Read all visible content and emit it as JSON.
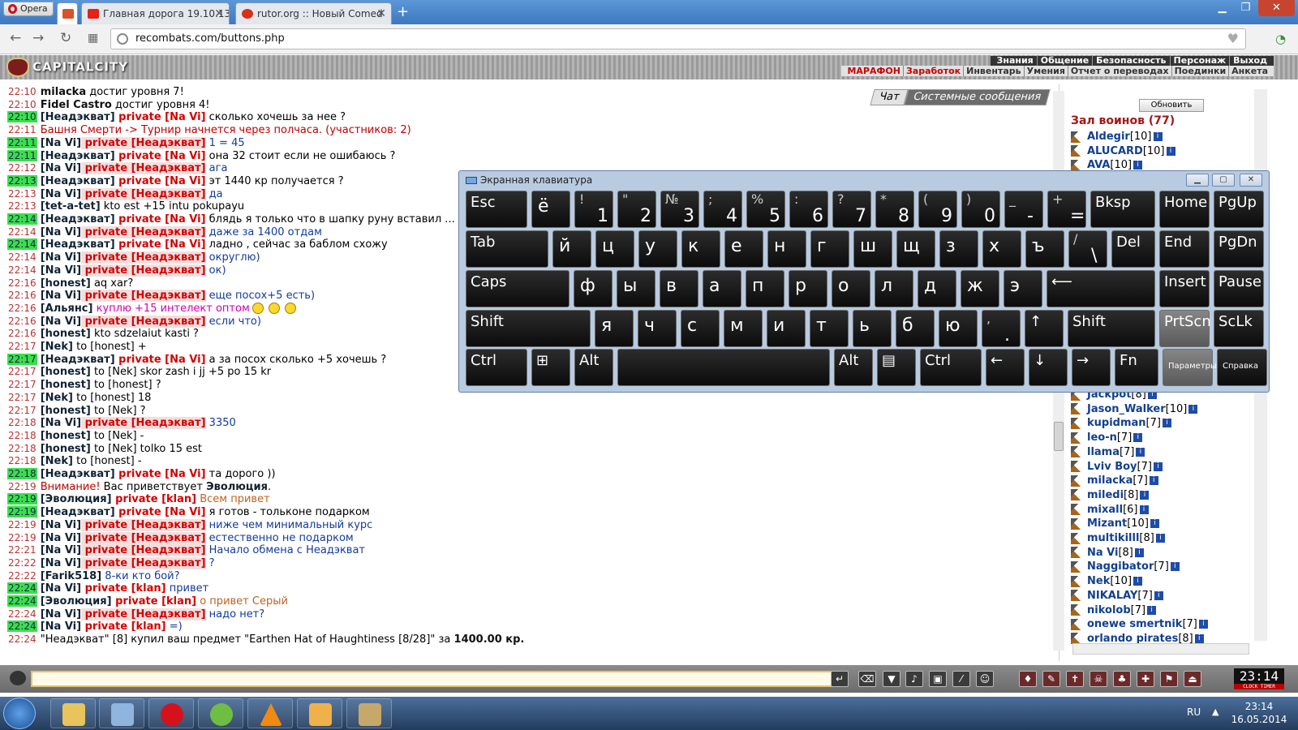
{
  "browser": {
    "menu_label": "Opera",
    "tabs": [
      {
        "label": ""
      },
      {
        "label": "Главная дорога 19.10.13 -"
      },
      {
        "label": "rutor.org :: Новый Comed"
      }
    ],
    "url": "recombats.com/buttons.php"
  },
  "game": {
    "logo": "CAPITALCITY",
    "top_menu": [
      "Знания",
      "Общение",
      "Безопасность",
      "Персонаж",
      "Выход"
    ],
    "sub_menu": [
      "МАРАФОН",
      "Заработок",
      "Инвентарь",
      "Умения",
      "Отчет о переводах",
      "Поединки",
      "Анкета"
    ],
    "chat_tabs": [
      "Чат",
      "Системные сообщения"
    ],
    "refresh_label": "Обновить",
    "hall_title": "Зал воинов (77)"
  },
  "chat": [
    {
      "ts": "22:10",
      "hl": false,
      "parts": [
        {
          "c": "nick",
          "t": "milacka"
        },
        {
          "c": "t",
          "t": " достиг уровня 7!"
        }
      ]
    },
    {
      "ts": "22:10",
      "hl": false,
      "parts": [
        {
          "c": "nick",
          "t": "Fidel Castro"
        },
        {
          "c": "t",
          "t": " достиг уровня 4!"
        }
      ]
    },
    {
      "ts": "22:10",
      "hl": true,
      "parts": [
        {
          "c": "br",
          "t": "[Неадэкват]"
        },
        {
          "c": "priv",
          "t": " private [Na Vi]"
        },
        {
          "c": "t",
          "t": " сколько хочешь за нее ?"
        }
      ]
    },
    {
      "ts": "22:11",
      "hl": false,
      "parts": [
        {
          "c": "tr",
          "t": "Башня Смерти -> "
        },
        {
          "c": "tr",
          "t": "Турнир начнется через полчаса. (участников: 2)"
        }
      ]
    },
    {
      "ts": "22:11",
      "hl": true,
      "parts": [
        {
          "c": "br",
          "t": "[Na Vi]"
        },
        {
          "c": "privb",
          "t": " private [Неадэкват]"
        },
        {
          "c": "tb",
          "t": " 1 = 45"
        }
      ]
    },
    {
      "ts": "22:11",
      "hl": true,
      "parts": [
        {
          "c": "br",
          "t": "[Неадэкват]"
        },
        {
          "c": "priv",
          "t": " private [Na Vi]"
        },
        {
          "c": "t",
          "t": " она 32 стоит если не ошибаюсь ?"
        }
      ]
    },
    {
      "ts": "22:12",
      "hl": false,
      "parts": [
        {
          "c": "br",
          "t": "[Na Vi]"
        },
        {
          "c": "privb",
          "t": " private [Неадэкват]"
        },
        {
          "c": "tb",
          "t": " ага"
        }
      ]
    },
    {
      "ts": "22:13",
      "hl": true,
      "parts": [
        {
          "c": "br",
          "t": "[Неадэкват]"
        },
        {
          "c": "priv",
          "t": " private [Na Vi]"
        },
        {
          "c": "t",
          "t": " эт 1440 кр получается ?"
        }
      ]
    },
    {
      "ts": "22:13",
      "hl": false,
      "parts": [
        {
          "c": "br",
          "t": "[Na Vi]"
        },
        {
          "c": "privb",
          "t": " private [Неадэкват]"
        },
        {
          "c": "tb",
          "t": " да"
        }
      ]
    },
    {
      "ts": "22:13",
      "hl": false,
      "parts": [
        {
          "c": "br",
          "t": "[tet-a-tet]"
        },
        {
          "c": "t",
          "t": " kto est +15 intu pokupayu"
        }
      ]
    },
    {
      "ts": "22:14",
      "hl": true,
      "parts": [
        {
          "c": "br",
          "t": "[Неадэкват]"
        },
        {
          "c": "priv",
          "t": " private [Na Vi]"
        },
        {
          "c": "t",
          "t": " блядь я только что в шапку руну вставил ..."
        }
      ]
    },
    {
      "ts": "22:14",
      "hl": false,
      "parts": [
        {
          "c": "br",
          "t": "[Na Vi]"
        },
        {
          "c": "privb",
          "t": " private [Неадэкват]"
        },
        {
          "c": "tb",
          "t": " даже за 1400 отдам"
        }
      ]
    },
    {
      "ts": "22:14",
      "hl": true,
      "parts": [
        {
          "c": "br",
          "t": "[Неадэкват]"
        },
        {
          "c": "priv",
          "t": " private [Na Vi]"
        },
        {
          "c": "t",
          "t": " ладно , сейчас за баблом схожу"
        }
      ]
    },
    {
      "ts": "22:14",
      "hl": false,
      "parts": [
        {
          "c": "br",
          "t": "[Na Vi]"
        },
        {
          "c": "privb",
          "t": " private [Неадэкват]"
        },
        {
          "c": "tb",
          "t": " округлю)"
        }
      ]
    },
    {
      "ts": "22:14",
      "hl": false,
      "parts": [
        {
          "c": "br",
          "t": "[Na Vi]"
        },
        {
          "c": "privb",
          "t": " private [Неадэкват]"
        },
        {
          "c": "tb",
          "t": " ок)"
        }
      ]
    },
    {
      "ts": "22:16",
      "hl": false,
      "parts": [
        {
          "c": "br",
          "t": "[honest]"
        },
        {
          "c": "t",
          "t": " aq xar?"
        }
      ]
    },
    {
      "ts": "22:16",
      "hl": false,
      "parts": [
        {
          "c": "br",
          "t": "[Na Vi]"
        },
        {
          "c": "privb",
          "t": " private [Неадэкват]"
        },
        {
          "c": "tb",
          "t": " еще посох+5 есть)"
        }
      ]
    },
    {
      "ts": "22:16",
      "hl": false,
      "smiles": true,
      "parts": [
        {
          "c": "br",
          "t": "[Альянс]"
        },
        {
          "c": "tm",
          "t": " куплю +15 интелект оптом"
        }
      ]
    },
    {
      "ts": "22:16",
      "hl": false,
      "parts": [
        {
          "c": "br",
          "t": "[Na Vi]"
        },
        {
          "c": "privb",
          "t": " private [Неадэкват]"
        },
        {
          "c": "tb",
          "t": " если что)"
        }
      ]
    },
    {
      "ts": "22:16",
      "hl": false,
      "parts": [
        {
          "c": "br",
          "t": "[honest]"
        },
        {
          "c": "t",
          "t": " kto sdzelaiut kasti ?"
        }
      ]
    },
    {
      "ts": "22:17",
      "hl": false,
      "parts": [
        {
          "c": "br",
          "t": "[Nek]"
        },
        {
          "c": "t",
          "t": " to [honest] +"
        }
      ]
    },
    {
      "ts": "22:17",
      "hl": true,
      "parts": [
        {
          "c": "br",
          "t": "[Неадэкват]"
        },
        {
          "c": "priv",
          "t": " private [Na Vi]"
        },
        {
          "c": "t",
          "t": " а за посох сколько +5 хочешь ?"
        }
      ]
    },
    {
      "ts": "22:17",
      "hl": false,
      "parts": [
        {
          "c": "br",
          "t": "[honest]"
        },
        {
          "c": "t",
          "t": " to [Nek] skor zash i jj +5 po 15 kr"
        }
      ]
    },
    {
      "ts": "22:17",
      "hl": false,
      "parts": [
        {
          "c": "br",
          "t": "[honest]"
        },
        {
          "c": "t",
          "t": " to [honest] ?"
        }
      ]
    },
    {
      "ts": "22:17",
      "hl": false,
      "parts": [
        {
          "c": "br",
          "t": "[Nek]"
        },
        {
          "c": "t",
          "t": " to [honest] 18"
        }
      ]
    },
    {
      "ts": "22:17",
      "hl": false,
      "parts": [
        {
          "c": "br",
          "t": "[honest]"
        },
        {
          "c": "t",
          "t": " to [Nek] ?"
        }
      ]
    },
    {
      "ts": "22:18",
      "hl": false,
      "parts": [
        {
          "c": "br",
          "t": "[Na Vi]"
        },
        {
          "c": "privb",
          "t": " private [Неадэкват]"
        },
        {
          "c": "tb",
          "t": " 3350"
        }
      ]
    },
    {
      "ts": "22:18",
      "hl": false,
      "parts": [
        {
          "c": "br",
          "t": "[honest]"
        },
        {
          "c": "t",
          "t": " to [Nek] -"
        }
      ]
    },
    {
      "ts": "22:18",
      "hl": false,
      "parts": [
        {
          "c": "br",
          "t": "[honest]"
        },
        {
          "c": "t",
          "t": " to [Nek] tolko 15 est"
        }
      ]
    },
    {
      "ts": "22:18",
      "hl": false,
      "parts": [
        {
          "c": "br",
          "t": "[Nek]"
        },
        {
          "c": "t",
          "t": " to [honest] -"
        }
      ]
    },
    {
      "ts": "22:18",
      "hl": true,
      "parts": [
        {
          "c": "br",
          "t": "[Неадэкват]"
        },
        {
          "c": "priv",
          "t": " private [Na Vi]"
        },
        {
          "c": "t",
          "t": " та дорого ))"
        }
      ]
    },
    {
      "ts": "22:19",
      "hl": false,
      "parts": [
        {
          "c": "tr",
          "t": "Внимание!"
        },
        {
          "c": "t",
          "t": " Вас приветствует "
        },
        {
          "c": "br",
          "t": "Эволюция"
        },
        {
          "c": "t",
          "t": "."
        }
      ]
    },
    {
      "ts": "22:19",
      "hl": true,
      "parts": [
        {
          "c": "br",
          "t": "[Эволюция]"
        },
        {
          "c": "priv",
          "t": " private [klan]"
        },
        {
          "c": "to",
          "t": " Всем привет"
        }
      ]
    },
    {
      "ts": "22:19",
      "hl": true,
      "parts": [
        {
          "c": "br",
          "t": "[Неадэкват]"
        },
        {
          "c": "priv",
          "t": " private [Na Vi]"
        },
        {
          "c": "t",
          "t": " я готов - тольконе подарком"
        }
      ]
    },
    {
      "ts": "22:19",
      "hl": false,
      "parts": [
        {
          "c": "br",
          "t": "[Na Vi]"
        },
        {
          "c": "privb",
          "t": " private [Неадэкват]"
        },
        {
          "c": "tb",
          "t": " ниже чем минимальный курс"
        }
      ]
    },
    {
      "ts": "22:19",
      "hl": false,
      "parts": [
        {
          "c": "br",
          "t": "[Na Vi]"
        },
        {
          "c": "privb",
          "t": " private [Неадэкват]"
        },
        {
          "c": "tb",
          "t": " естественно не подарком"
        }
      ]
    },
    {
      "ts": "22:21",
      "hl": false,
      "parts": [
        {
          "c": "br",
          "t": "[Na Vi]"
        },
        {
          "c": "privb",
          "t": " private [Неадэкват]"
        },
        {
          "c": "tb",
          "t": " Начало обмена с Неадэкват"
        }
      ]
    },
    {
      "ts": "22:22",
      "hl": false,
      "parts": [
        {
          "c": "br",
          "t": "[Na Vi]"
        },
        {
          "c": "privb",
          "t": " private [Неадэкват]"
        },
        {
          "c": "tb",
          "t": " ?"
        }
      ]
    },
    {
      "ts": "22:22",
      "hl": false,
      "parts": [
        {
          "c": "br",
          "t": "[Farik518]"
        },
        {
          "c": "tb",
          "t": " 8-ки кто бой?"
        }
      ]
    },
    {
      "ts": "22:24",
      "hl": true,
      "parts": [
        {
          "c": "br",
          "t": "[Na Vi]"
        },
        {
          "c": "priv",
          "t": " private [klan]"
        },
        {
          "c": "tb",
          "t": " привет"
        }
      ]
    },
    {
      "ts": "22:24",
      "hl": true,
      "parts": [
        {
          "c": "br",
          "t": "[Эволюция]"
        },
        {
          "c": "priv",
          "t": " private [klan]"
        },
        {
          "c": "to",
          "t": " о привет Серый"
        }
      ]
    },
    {
      "ts": "22:24",
      "hl": false,
      "parts": [
        {
          "c": "br",
          "t": "[Na Vi]"
        },
        {
          "c": "privb",
          "t": " private [Неадэкват]"
        },
        {
          "c": "tb",
          "t": " надо нет?"
        }
      ]
    },
    {
      "ts": "22:24",
      "hl": true,
      "parts": [
        {
          "c": "br",
          "t": "[Na Vi]"
        },
        {
          "c": "priv",
          "t": " private [klan]"
        },
        {
          "c": "tb",
          "t": " =)"
        }
      ]
    },
    {
      "ts": "22:24",
      "hl": false,
      "parts": [
        {
          "c": "t",
          "t": "\"Неадэкват\" [8] купил ваш предмет \"Earthen Hat of Haughtiness [8/28]\" за "
        },
        {
          "c": "nick",
          "t": "1400.00 кр."
        }
      ]
    }
  ],
  "players_top": [
    {
      "name": "Aldegir",
      "level": "[10]"
    },
    {
      "name": "ALUCARD",
      "level": "[10]"
    },
    {
      "name": "AVA",
      "level": "[10]"
    }
  ],
  "players": [
    {
      "name": "Jackpot",
      "level": "[8]"
    },
    {
      "name": "Jason_Walker",
      "level": "[10]"
    },
    {
      "name": "kupidman",
      "level": "[7]"
    },
    {
      "name": "leo-n",
      "level": "[7]"
    },
    {
      "name": "llama",
      "level": "[7]"
    },
    {
      "name": "Lviv Boy",
      "level": "[7]"
    },
    {
      "name": "milacka",
      "level": "[7]"
    },
    {
      "name": "miledi",
      "level": "[8]"
    },
    {
      "name": "mixall",
      "level": "[6]"
    },
    {
      "name": "Mizant",
      "level": "[10]"
    },
    {
      "name": "multikilll",
      "level": "[8]"
    },
    {
      "name": "Na Vi",
      "level": "[8]"
    },
    {
      "name": "Naggibator",
      "level": "[7]"
    },
    {
      "name": "Nek",
      "level": "[10]"
    },
    {
      "name": "NIKALAY",
      "level": "[7]"
    },
    {
      "name": "nikolob",
      "level": "[7]"
    },
    {
      "name": "onewe smertnik",
      "level": "[7]"
    },
    {
      "name": "orlando pirates",
      "level": "[8]"
    }
  ],
  "osk": {
    "title": "Экранная клавиатура",
    "rows": [
      [
        {
          "l": "Esc",
          "w": 76
        },
        {
          "cy": "ё",
          "w": 48
        },
        {
          "sh": "!",
          "mn": "1",
          "w": 48
        },
        {
          "sh": "\"",
          "mn": "2",
          "w": 48
        },
        {
          "sh": "№",
          "mn": "3",
          "w": 48
        },
        {
          "sh": ";",
          "mn": "4",
          "w": 48
        },
        {
          "sh": "%",
          "mn": "5",
          "w": 48
        },
        {
          "sh": ":",
          "mn": "6",
          "w": 48
        },
        {
          "sh": "?",
          "mn": "7",
          "w": 48
        },
        {
          "sh": "*",
          "mn": "8",
          "w": 48
        },
        {
          "sh": "(",
          "mn": "9",
          "w": 48
        },
        {
          "sh": ")",
          "mn": "0",
          "w": 48
        },
        {
          "sh": "_",
          "mn": "-",
          "w": 48
        },
        {
          "sh": "+",
          "mn": "=",
          "w": 48
        },
        {
          "l": "Bksp",
          "w": 80
        },
        {
          "l": "Home",
          "w": 62
        },
        {
          "l": "PgUp",
          "w": 62
        }
      ],
      [
        {
          "l": "Tab",
          "w": 102
        },
        {
          "cy": "й",
          "w": 48
        },
        {
          "cy": "ц",
          "w": 48
        },
        {
          "cy": "у",
          "w": 48
        },
        {
          "cy": "к",
          "w": 48
        },
        {
          "cy": "е",
          "w": 48
        },
        {
          "cy": "н",
          "w": 48
        },
        {
          "cy": "г",
          "w": 48
        },
        {
          "cy": "ш",
          "w": 48
        },
        {
          "cy": "щ",
          "w": 48
        },
        {
          "cy": "з",
          "w": 48
        },
        {
          "cy": "х",
          "w": 48
        },
        {
          "cy": "ъ",
          "w": 48
        },
        {
          "sh": "/",
          "mn": "\\",
          "w": 48
        },
        {
          "l": "Del",
          "w": 54
        },
        {
          "l": "End",
          "w": 62
        },
        {
          "l": "PgDn",
          "w": 62
        }
      ],
      [
        {
          "l": "Caps",
          "w": 128
        },
        {
          "cy": "ф",
          "w": 48
        },
        {
          "cy": "ы",
          "w": 48
        },
        {
          "cy": "в",
          "w": 48
        },
        {
          "cy": "а",
          "w": 48
        },
        {
          "cy": "п",
          "w": 48
        },
        {
          "cy": "р",
          "w": 48
        },
        {
          "cy": "о",
          "w": 48
        },
        {
          "cy": "л",
          "w": 48
        },
        {
          "cy": "д",
          "w": 48
        },
        {
          "cy": "ж",
          "w": 48
        },
        {
          "cy": "э",
          "w": 48
        },
        {
          "l": "⟵",
          "w": 134
        },
        {
          "l": "Insert",
          "w": 62
        },
        {
          "l": "Pause",
          "w": 62
        }
      ],
      [
        {
          "l": "Shift",
          "w": 154
        },
        {
          "cy": "я",
          "w": 48
        },
        {
          "cy": "ч",
          "w": 48
        },
        {
          "cy": "с",
          "w": 48
        },
        {
          "cy": "м",
          "w": 48
        },
        {
          "cy": "и",
          "w": 48
        },
        {
          "cy": "т",
          "w": 48
        },
        {
          "cy": "ь",
          "w": 48
        },
        {
          "cy": "б",
          "w": 48
        },
        {
          "cy": "ю",
          "w": 48
        },
        {
          "sh": ",",
          "mn": ".",
          "w": 48
        },
        {
          "l": "↑",
          "w": 48
        },
        {
          "l": "Shift",
          "w": 108
        },
        {
          "l": "PrtScn",
          "w": 62,
          "gray": true
        },
        {
          "l": "ScLk",
          "w": 62
        }
      ],
      [
        {
          "l": "Ctrl",
          "w": 76
        },
        {
          "l": "⊞",
          "w": 48
        },
        {
          "l": "Alt",
          "w": 48
        },
        {
          "l": "",
          "w": 262
        },
        {
          "l": "Alt",
          "w": 48
        },
        {
          "l": "▤",
          "w": 48
        },
        {
          "l": "Ctrl",
          "w": 76
        },
        {
          "l": "←",
          "w": 48
        },
        {
          "l": "↓",
          "w": 48
        },
        {
          "l": "→",
          "w": 48
        },
        {
          "l": "Fn",
          "w": 54
        },
        {
          "sm": "Параметры",
          "w": 62,
          "gray": true
        },
        {
          "sm": "Справка",
          "w": 62
        }
      ]
    ]
  },
  "clock": {
    "time": "23:14",
    "caption": "CLOCK TIMER"
  },
  "tray": {
    "lang": "RU",
    "time": "23:14",
    "date": "16.05.2014"
  }
}
